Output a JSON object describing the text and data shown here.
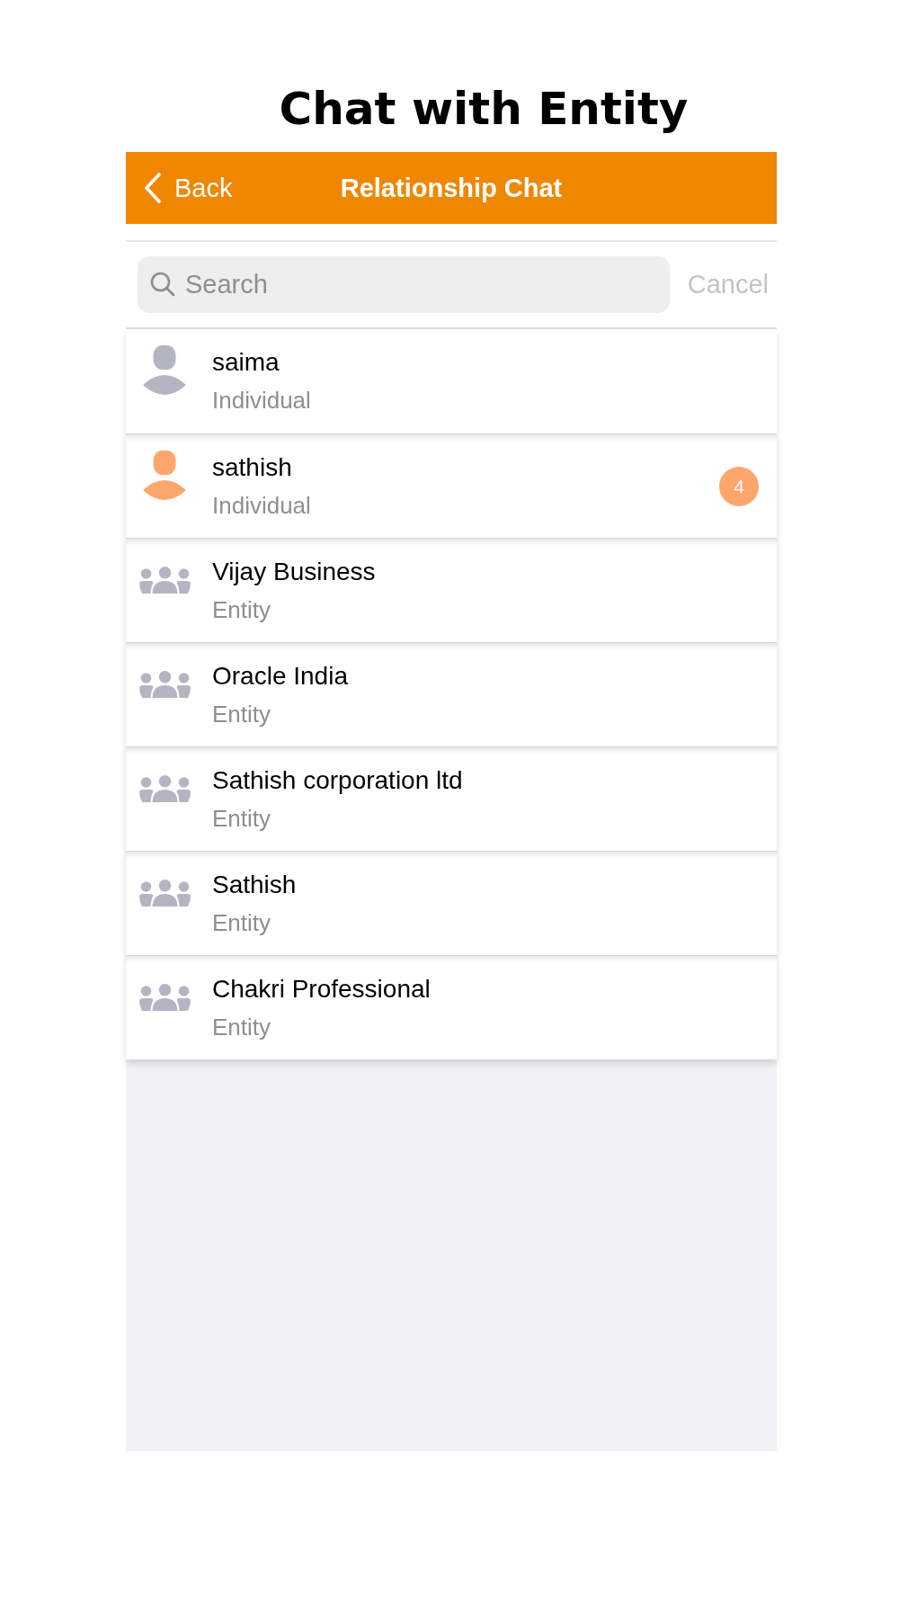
{
  "page_title": "Chat with Entity",
  "nav_bar": {
    "back_label": "Back",
    "title": "Relationship Chat"
  },
  "search": {
    "placeholder": "Search",
    "cancel_label": "Cancel"
  },
  "chats": [
    {
      "kind": "individual",
      "name": "saima",
      "subtitle": "Individual",
      "color": "#b4b5c2"
    },
    {
      "kind": "individual",
      "name": "sathish",
      "subtitle": "Individual",
      "color": "#ffa66d",
      "badge": "4"
    },
    {
      "kind": "entity",
      "name": "Vijay Business",
      "subtitle": "Entity",
      "color": "#b4b5c2"
    },
    {
      "kind": "entity",
      "name": "Oracle India",
      "subtitle": "Entity",
      "color": "#b4b5c2"
    },
    {
      "kind": "entity",
      "name": "Sathish corporation ltd",
      "subtitle": "Entity",
      "color": "#b4b5c2"
    },
    {
      "kind": "entity",
      "name": "Sathish",
      "subtitle": "Entity",
      "color": "#b4b5c2"
    },
    {
      "kind": "entity",
      "name": "Chakri Professional",
      "subtitle": "Entity",
      "color": "#b4b5c2"
    }
  ]
}
